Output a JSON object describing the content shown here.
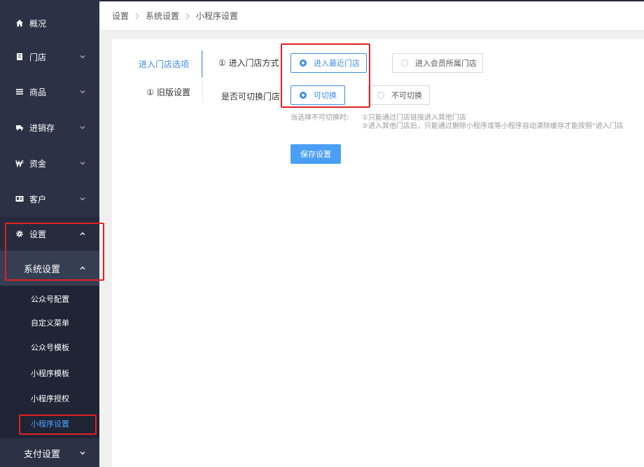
{
  "breadcrumb": [
    "设置",
    "系统设置",
    "小程序设置"
  ],
  "sidebar": {
    "items": [
      {
        "label": "概况",
        "icon": "home-icon",
        "has_chevron": false
      },
      {
        "label": "门店",
        "icon": "store-icon",
        "has_chevron": true
      },
      {
        "label": "商品",
        "icon": "list-icon",
        "has_chevron": true
      },
      {
        "label": "进销存",
        "icon": "truck-icon",
        "has_chevron": true
      },
      {
        "label": "资金",
        "icon": "won-icon",
        "has_chevron": true
      },
      {
        "label": "客户",
        "icon": "id-card-icon",
        "has_chevron": true
      },
      {
        "label": "设置",
        "icon": "gear-icon",
        "has_chevron": true,
        "expanded": true
      }
    ],
    "system_settings": {
      "label": "系统设置",
      "expanded": true
    },
    "sub_items": [
      "公众号配置",
      "自定义菜单",
      "公众号模板",
      "小程序模板",
      "小程序授权",
      "小程序设置"
    ],
    "selected_sub_item": "小程序设置",
    "bottom_item": {
      "label": "支付设置"
    }
  },
  "tabs": [
    {
      "label": "进入门店选项",
      "active": true
    },
    {
      "label": "① 旧版设置",
      "active": false
    }
  ],
  "form": {
    "entry_mode": {
      "label": "① 进入门店方式",
      "options": [
        "进入最近门店",
        "进入会员所属门店"
      ],
      "selected": "进入最近门店"
    },
    "switchable": {
      "label": "是否可切换门店",
      "options": [
        "可切换",
        "不可切换"
      ],
      "selected": "可切换"
    },
    "hint_prefix": "当选择不可切换时:",
    "hint_line1": "①只能通过门店链接进入其他门店",
    "hint_line2": "②进入其他门店后，只能通过删除小程序或等小程序自动清除缓存才能按照\"进入门店",
    "save_label": "保存设置"
  },
  "colors": {
    "sidebar_bg": "#2b3245",
    "accent": "#3a8ee6",
    "button_bg": "#4a9ff5",
    "highlight": "#e02020"
  }
}
